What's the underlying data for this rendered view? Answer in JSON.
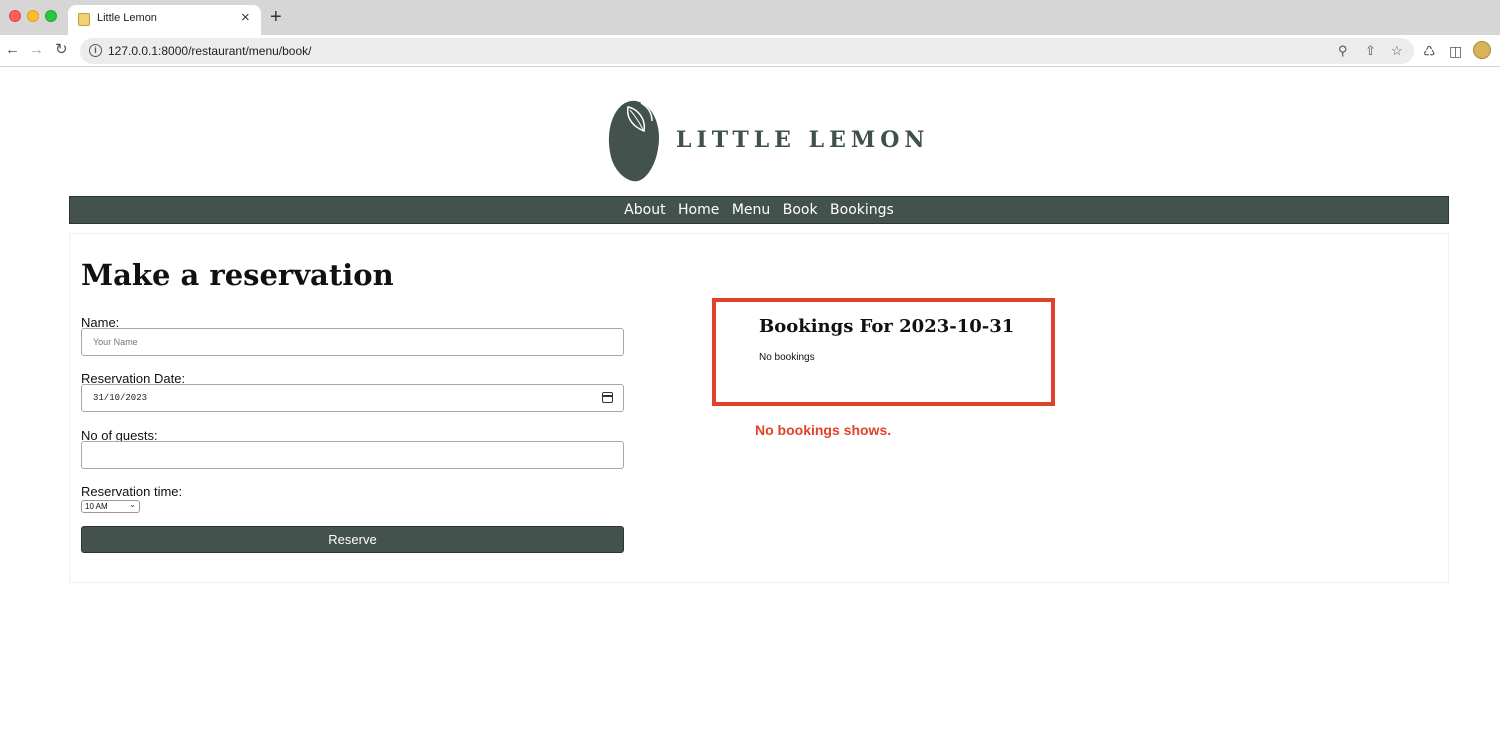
{
  "browser": {
    "tab_title": "Little Lemon",
    "tab_close": "×",
    "new_tab": "+",
    "url": "127.0.0.1:8000/restaurant/menu/book/",
    "icons": [
      "back-icon",
      "forward-icon",
      "reload-icon",
      "info-icon",
      "zoom-icon",
      "share-icon",
      "star-icon",
      "extensions-icon",
      "sidebar-icon",
      "profile-avatar"
    ]
  },
  "site": {
    "brand": "LITTLE LEMON",
    "nav": [
      "About",
      "Home",
      "Menu",
      "Book",
      "Bookings"
    ],
    "colors": {
      "primary": "#43524d",
      "accent": "#e0432a"
    }
  },
  "form": {
    "heading": "Make a reservation",
    "name_label": "Name:",
    "name_placeholder": "Your Name",
    "date_label": "Reservation Date:",
    "date_value": "31/10/2023",
    "guests_label": "No of guests:",
    "guests_value": "",
    "time_label": "Reservation time:",
    "time_value": "10 AM",
    "submit_label": "Reserve"
  },
  "bookings": {
    "title": "Bookings For 2023-10-31",
    "empty_text": "No bookings"
  },
  "annotation": "No bookings shows."
}
